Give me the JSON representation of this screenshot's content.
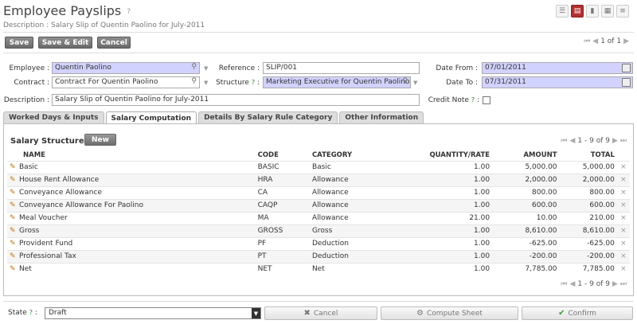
{
  "header": {
    "title": "Employee Payslips",
    "help": "?",
    "subtitle": "Description : Salary Slip of Quentin Paolino for July-2011"
  },
  "view_switch": [
    "list-view-icon",
    "form-view-icon",
    "graph-view-icon",
    "calendar-view-icon",
    "gantt-view-icon"
  ],
  "toolbar": {
    "save_label": "Save",
    "save_edit_label": "Save & Edit",
    "cancel_label": "Cancel"
  },
  "pager": {
    "first": "⏮",
    "prev": "◀",
    "text": "1 of 1",
    "next": "▶"
  },
  "form": {
    "employee_label": "Employee :",
    "employee_value": "Quentin Paolino",
    "reference_label": "Reference :",
    "reference_value": "SLIP/001",
    "date_from_label": "Date From :",
    "date_from_value": "07/01/2011",
    "contract_label": "Contract :",
    "contract_value": "Contract For Quentin Paolino",
    "structure_label": "Structure",
    "structure_value": "Marketing Executive for Quentin Paolino",
    "date_to_label": "Date To :",
    "date_to_value": "07/31/2011",
    "description_label": "Description :",
    "description_value": "Salary Slip of Quentin Paolino for July-2011",
    "credit_note_label": "Credit Note",
    "help": "?",
    "colon": ":"
  },
  "tabs": [
    {
      "label": "Worked Days & Inputs",
      "active": false
    },
    {
      "label": "Salary Computation",
      "active": true
    },
    {
      "label": "Details By Salary Rule Category",
      "active": false
    },
    {
      "label": "Other Information",
      "active": false
    }
  ],
  "salary_structure": {
    "title": "Salary Structure",
    "new_label": "New",
    "pager_text": "1 - 9 of 9",
    "columns": [
      "NAME",
      "CODE",
      "CATEGORY",
      "QUANTITY/RATE",
      "AMOUNT",
      "TOTAL"
    ],
    "rows": [
      {
        "name": "Basic",
        "code": "BASIC",
        "category": "Basic",
        "qty": "1.00",
        "amount": "5,000.00",
        "total": "5,000.00"
      },
      {
        "name": "House Rent Allowance",
        "code": "HRA",
        "category": "Allowance",
        "qty": "1.00",
        "amount": "2,000.00",
        "total": "2,000.00"
      },
      {
        "name": "Conveyance Allowance",
        "code": "CA",
        "category": "Allowance",
        "qty": "1.00",
        "amount": "800.00",
        "total": "800.00"
      },
      {
        "name": "Conveyance Allowance For Paolino",
        "code": "CAQP",
        "category": "Allowance",
        "qty": "1.00",
        "amount": "600.00",
        "total": "600.00"
      },
      {
        "name": "Meal Voucher",
        "code": "MA",
        "category": "Allowance",
        "qty": "21.00",
        "amount": "10.00",
        "total": "210.00"
      },
      {
        "name": "Gross",
        "code": "GROSS",
        "category": "Gross",
        "qty": "1.00",
        "amount": "8,610.00",
        "total": "8,610.00"
      },
      {
        "name": "Provident Fund",
        "code": "PF",
        "category": "Deduction",
        "qty": "1.00",
        "amount": "-625.00",
        "total": "-625.00"
      },
      {
        "name": "Professional Tax",
        "code": "PT",
        "category": "Deduction",
        "qty": "1.00",
        "amount": "-200.00",
        "total": "-200.00"
      },
      {
        "name": "Net",
        "code": "NET",
        "category": "Net",
        "qty": "1.00",
        "amount": "7,785.00",
        "total": "7,785.00"
      }
    ],
    "delete_glyph": "×"
  },
  "footer": {
    "state_label": "State",
    "state_help": "?",
    "state_colon": ":",
    "state_value": "Draft",
    "cancel_label": "Cancel",
    "compute_label": "Compute Sheet",
    "confirm_label": "Confirm"
  },
  "colors": {
    "required_field": "#d2d2ff",
    "active_view": "#b03030",
    "confirm_check": "#3a9a3a"
  }
}
